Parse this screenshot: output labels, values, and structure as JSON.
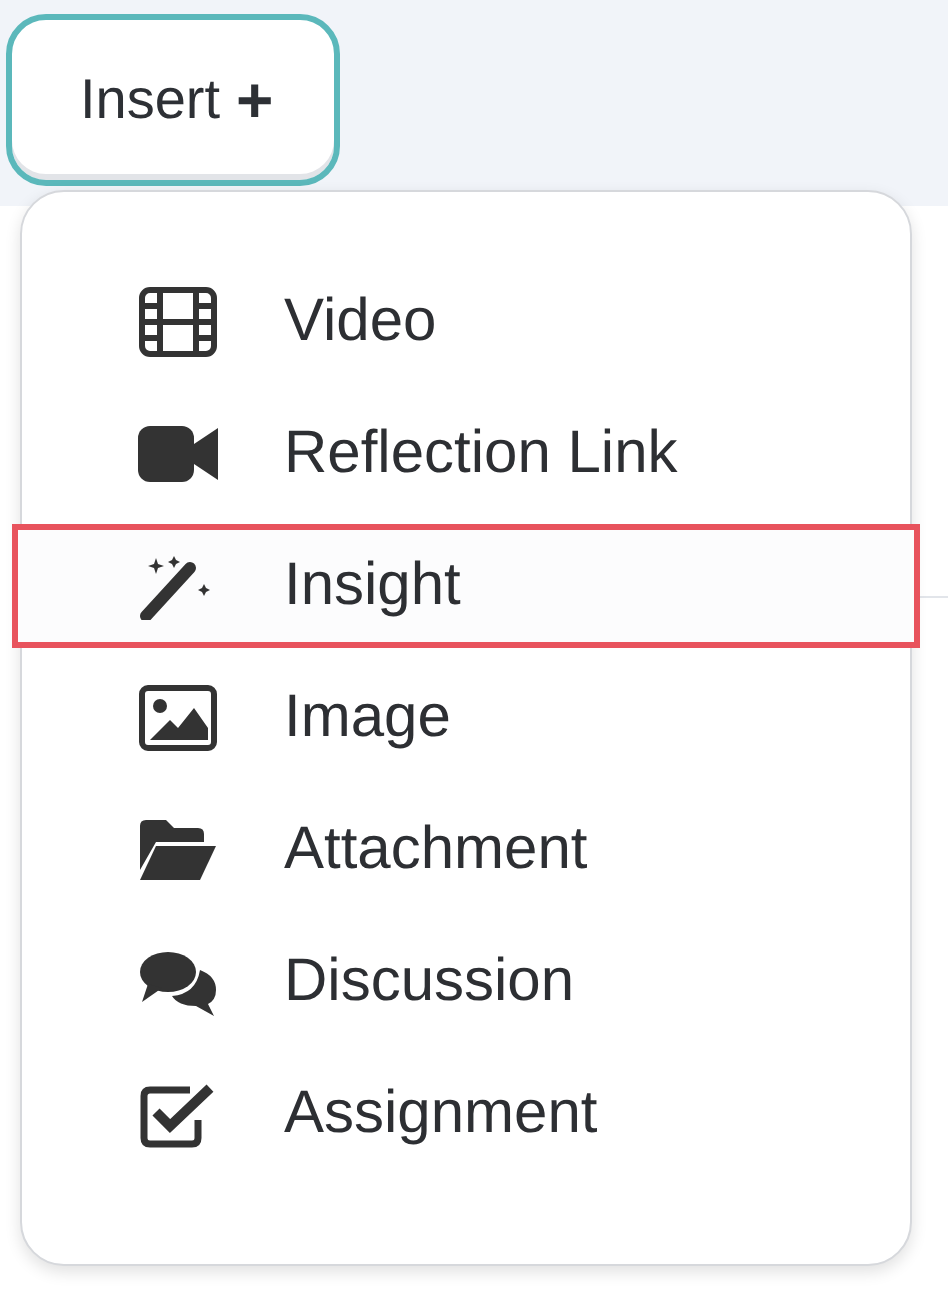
{
  "insert_button": {
    "label": "Insert",
    "icon": "+"
  },
  "menu": {
    "items": [
      {
        "kind": "film",
        "label": "Video",
        "selected": false
      },
      {
        "kind": "camera",
        "label": "Reflection Link",
        "selected": false
      },
      {
        "kind": "wand",
        "label": "Insight",
        "selected": true
      },
      {
        "kind": "image",
        "label": "Image",
        "selected": false
      },
      {
        "kind": "folder",
        "label": "Attachment",
        "selected": false
      },
      {
        "kind": "comments",
        "label": "Discussion",
        "selected": false
      },
      {
        "kind": "checkbox",
        "label": "Assignment",
        "selected": false
      }
    ]
  }
}
